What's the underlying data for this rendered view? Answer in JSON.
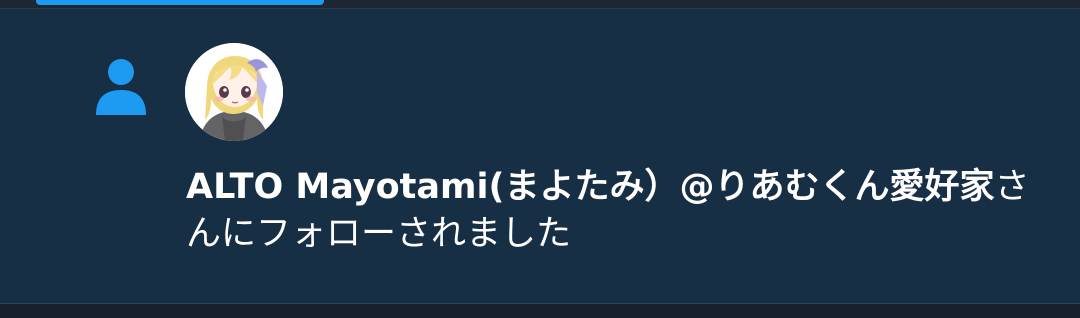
{
  "notification": {
    "user_name": "ALTO Mayotami(まよたみ）@りあむくん愛好家",
    "message_suffix": "さんにフォローされました",
    "icon": "person-icon",
    "avatar_icon": "anime-character-avatar"
  },
  "colors": {
    "background": "#172f44",
    "accent": "#1d9bf0",
    "text": "#ffffff"
  }
}
